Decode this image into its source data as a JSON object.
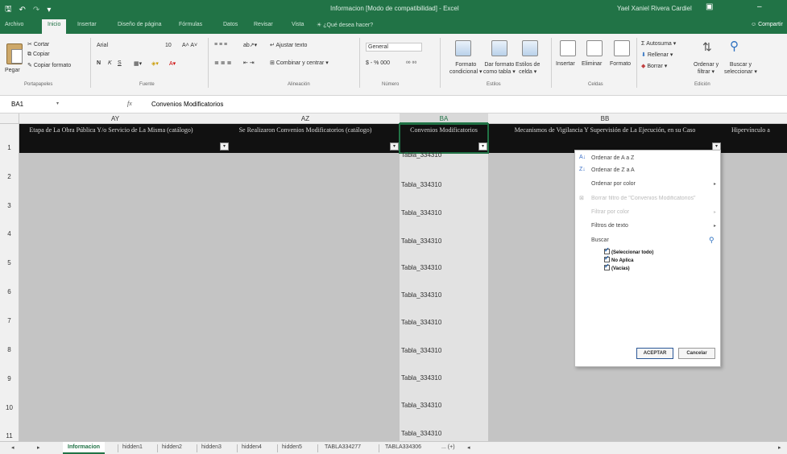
{
  "titlebar": {
    "title": "Informacion [Modo de compatibilidad] - Excel",
    "user": "Yael Xaniel Rivera Cardiel"
  },
  "tabs": {
    "items": [
      "Archivo",
      "Inicio",
      "Insertar",
      "Diseño de página",
      "Fórmulas",
      "Datos",
      "Revisar",
      "Vista",
      "¿Qué desea hacer?"
    ],
    "share": "Compartir"
  },
  "ribbon": {
    "paste": "Pegar",
    "cut": "Cortar",
    "copy": "Copiar",
    "format_painter": "Copiar formato",
    "clipboard_group": "Portapapeles",
    "font_name": "Arial",
    "font_size": "10",
    "bold": "N",
    "italic": "K",
    "underline": "S",
    "font_group": "Fuente",
    "wrap_text": "Ajustar texto",
    "merge_center": "Combinar y centrar",
    "alignment_group": "Alineación",
    "number_format": "General",
    "number_symbols": "$ - % 000",
    "number_group": "Número",
    "cond_format_1": "Formato",
    "cond_format_2": "condicional",
    "format_table_1": "Dar formato",
    "format_table_2": "como tabla",
    "cell_styles_1": "Estilos de",
    "cell_styles_2": "celda",
    "styles_group": "Estilos",
    "insert": "Insertar",
    "delete": "Eliminar",
    "format": "Formato",
    "cells_group": "Celdas",
    "autosum": "Autosuma",
    "fill": "Rellenar",
    "clear": "Borrar",
    "sort_filter_1": "Ordenar y",
    "sort_filter_2": "filtrar",
    "find_select_1": "Buscar y",
    "find_select_2": "seleccionar",
    "editing_group": "Edición"
  },
  "formula_bar": {
    "name_box": "BA1",
    "fx": "fx",
    "content": "Convenios Modificatorios"
  },
  "columns": [
    {
      "letter": "AY",
      "header": "Etapa de La Obra Pública Y/o Servicio de La Misma (catálogo)"
    },
    {
      "letter": "AZ",
      "header": "Se Realizaron Convenios Modificatorios (catálogo)"
    },
    {
      "letter": "BA",
      "header": "Convenios Modificatorios"
    },
    {
      "letter": "BB",
      "header": "Mecanismos de Vigilancia Y Supervisión de La Ejecución, en su Caso"
    },
    {
      "letter": "",
      "header": "Hipervínculo a"
    }
  ],
  "rows": [
    "1",
    "2",
    "3",
    "4",
    "5",
    "6",
    "7",
    "8",
    "9",
    "10",
    "11"
  ],
  "table_cells": [
    "Tabla_334310",
    "Tabla_334310",
    "Tabla_334310",
    "Tabla_334310",
    "Tabla_334310",
    "Tabla_334310",
    "Tabla_334310",
    "Tabla_334310",
    "Tabla_334310",
    "Tabla_334310",
    "Tabla_334310"
  ],
  "filter_menu": {
    "sort_az": "Ordenar de A a Z",
    "sort_za": "Ordenar de Z a A",
    "sort_color": "Ordenar por color",
    "clear_filter": "Borrar filtro de \"Convenios Modificatorios\"",
    "filter_color": "Filtrar por color",
    "text_filters": "Filtros de texto",
    "search": "Buscar",
    "options": [
      "(Seleccionar todo)",
      "No Aplica",
      "(Vacías)"
    ],
    "ok": "ACEPTAR",
    "cancel": "Cancelar"
  },
  "sheets": {
    "items": [
      "Informacion",
      "hidden1",
      "hidden2",
      "hidden3",
      "hidden4",
      "hidden5",
      "TABLA334277",
      "TABLA334306"
    ],
    "more": "... (+)"
  }
}
